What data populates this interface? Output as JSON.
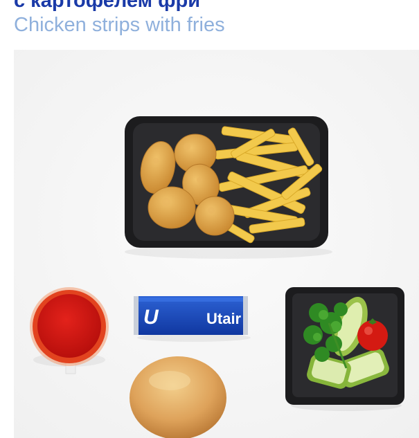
{
  "header": {
    "title_ru": "с картофелем фри",
    "title_en": "Chicken strips with fries"
  },
  "photo": {
    "items": [
      "chicken-nuggets-and-fries-tray",
      "tomato-sauce-cup",
      "utair-butter-bar",
      "salad-tray",
      "bread-bun"
    ],
    "brand_label": "Utair",
    "brand_logo": "U"
  },
  "colors": {
    "title_ru": "#1a3aa8",
    "title_en": "#8fb0dc",
    "brand_blue": "#1546b8"
  }
}
